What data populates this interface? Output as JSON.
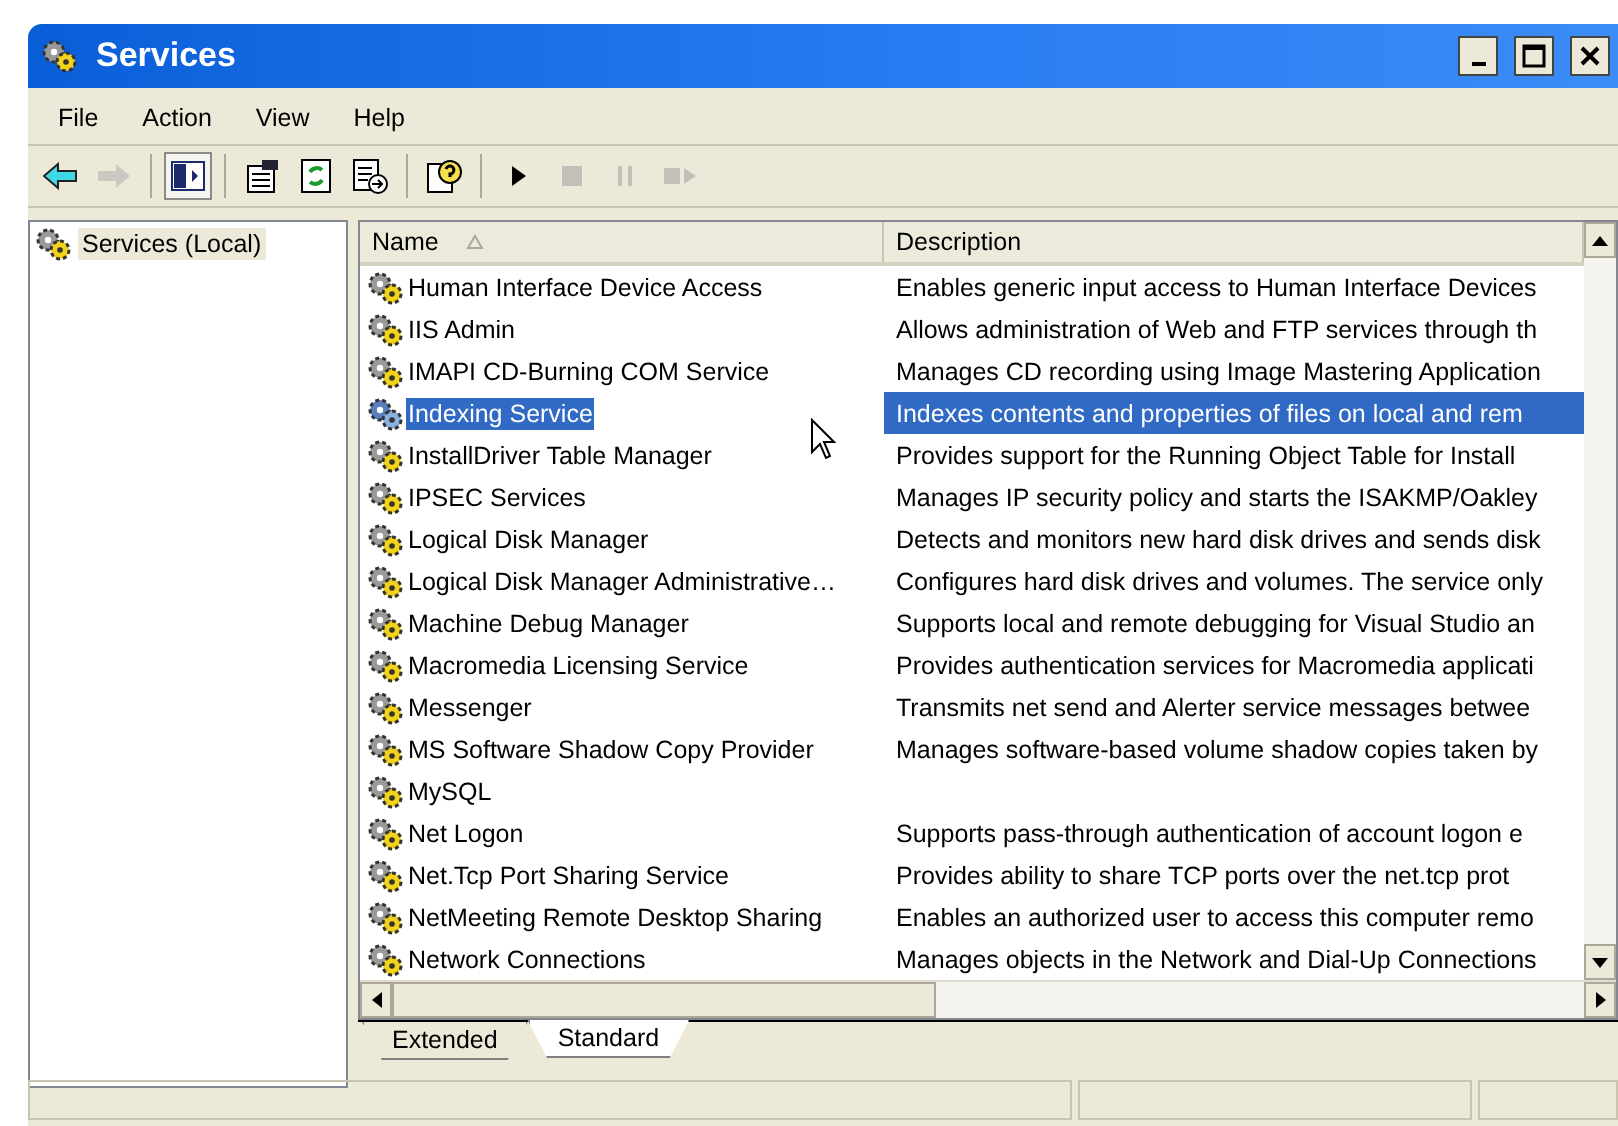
{
  "window": {
    "title": "Services"
  },
  "menu": [
    "File",
    "Action",
    "View",
    "Help"
  ],
  "toolbar": [
    {
      "kind": "back",
      "disabled": false,
      "pressed": false
    },
    {
      "kind": "forward",
      "disabled": true,
      "pressed": false
    },
    {
      "kind": "sep"
    },
    {
      "kind": "tree",
      "disabled": false,
      "pressed": true
    },
    {
      "kind": "sep"
    },
    {
      "kind": "properties",
      "disabled": false,
      "pressed": false
    },
    {
      "kind": "refresh",
      "disabled": false,
      "pressed": false
    },
    {
      "kind": "export",
      "disabled": false,
      "pressed": false
    },
    {
      "kind": "sep"
    },
    {
      "kind": "help",
      "disabled": false,
      "pressed": false
    },
    {
      "kind": "sep"
    },
    {
      "kind": "start",
      "disabled": false,
      "pressed": false
    },
    {
      "kind": "stop",
      "disabled": true,
      "pressed": false
    },
    {
      "kind": "pause",
      "disabled": true,
      "pressed": false
    },
    {
      "kind": "restart",
      "disabled": true,
      "pressed": false
    }
  ],
  "tree": [
    {
      "label": "Services (Local)",
      "selected": true
    }
  ],
  "columns": [
    {
      "label": "Name",
      "sorted": true
    },
    {
      "label": "Description",
      "sorted": false
    }
  ],
  "rows": [
    {
      "name": "Human Interface Device Access",
      "description": "Enables generic input access to Human Interface Devices",
      "selected": false
    },
    {
      "name": "IIS Admin",
      "description": "Allows administration of Web and FTP services through th",
      "selected": false
    },
    {
      "name": "IMAPI CD-Burning COM Service",
      "description": "Manages CD recording using Image Mastering Application",
      "selected": false
    },
    {
      "name": "Indexing Service",
      "description": "Indexes contents and properties of files on local and rem",
      "selected": true
    },
    {
      "name": "InstallDriver Table Manager",
      "description": "Provides support for the Running Object Table for Install",
      "selected": false
    },
    {
      "name": "IPSEC Services",
      "description": "Manages IP security policy and starts the ISAKMP/Oakley",
      "selected": false
    },
    {
      "name": "Logical Disk Manager",
      "description": "Detects and monitors new hard disk drives and sends disk",
      "selected": false
    },
    {
      "name": "Logical Disk Manager Administrative…",
      "description": "Configures hard disk drives and volumes. The service only",
      "selected": false
    },
    {
      "name": "Machine Debug Manager",
      "description": "Supports local and remote debugging for Visual Studio an",
      "selected": false
    },
    {
      "name": "Macromedia Licensing Service",
      "description": "Provides authentication services for Macromedia applicati",
      "selected": false
    },
    {
      "name": "Messenger",
      "description": "Transmits net send and Alerter service messages betwee",
      "selected": false
    },
    {
      "name": "MS Software Shadow Copy Provider",
      "description": "Manages software-based volume shadow copies taken by",
      "selected": false
    },
    {
      "name": "MySQL",
      "selected": false
    },
    {
      "name": "Net Logon",
      "description": "Supports pass-through authentication of account logon e",
      "selected": false
    },
    {
      "name": "Net.Tcp Port Sharing Service",
      "description": "Provides ability to share TCP ports over the net.tcp prot",
      "selected": false
    },
    {
      "name": "NetMeeting Remote Desktop Sharing",
      "description": "Enables an authorized user to access this computer remo",
      "selected": false
    },
    {
      "name": "Network Connections",
      "description": "Manages objects in the Network and Dial-Up Connections",
      "selected": false
    }
  ],
  "tabs": [
    {
      "label": "Extended",
      "selected": false
    },
    {
      "label": "Standard",
      "selected": true
    }
  ]
}
